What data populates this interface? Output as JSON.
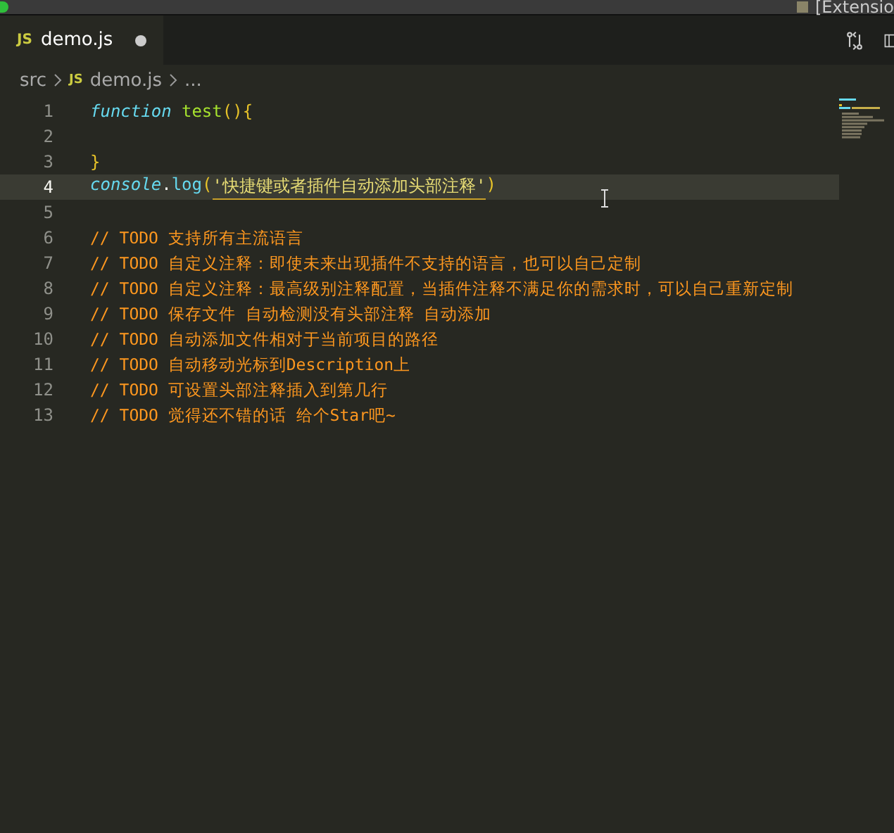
{
  "title_bar": {
    "text": "[Extensio"
  },
  "tabs": [
    {
      "icon": "JS",
      "label": "demo.js",
      "selected": true,
      "modified": true
    }
  ],
  "breadcrumb": [
    {
      "label": "src"
    },
    {
      "icon": "JS",
      "label": "demo.js"
    },
    {
      "label": "..."
    }
  ],
  "lines": [
    {
      "number": "1",
      "current": false,
      "tokens": [
        {
          "kind": "keyword",
          "text": "function"
        },
        {
          "kind": "func",
          "text": "test",
          "space_before": true
        },
        {
          "kind": "bracket",
          "text": "(){"
        }
      ]
    },
    {
      "number": "2",
      "current": false
    },
    {
      "number": "3",
      "current": false,
      "tokens": [
        {
          "kind": "bracket",
          "text": "}"
        }
      ]
    },
    {
      "number": "4",
      "current": true,
      "tokens": [
        {
          "kind": "object",
          "text": "console"
        },
        {
          "kind": "plain",
          "text": "."
        },
        {
          "kind": "method",
          "text": "log"
        },
        {
          "kind": "bracket",
          "text": "("
        },
        {
          "kind": "string",
          "text": "'快捷键或者插件自动添加头部注释'"
        },
        {
          "kind": "bracket",
          "text": ")"
        }
      ]
    },
    {
      "number": "5",
      "current": false
    },
    {
      "number": "6",
      "current": false,
      "tokens": [
        {
          "kind": "comment",
          "text": "// TODO 支持所有主流语言"
        }
      ]
    },
    {
      "number": "7",
      "current": false,
      "tokens": [
        {
          "kind": "comment",
          "text": "// TODO 自定义注释：即使未来出现插件不支持的语言，也可以自己定制"
        }
      ]
    },
    {
      "number": "8",
      "current": false,
      "tokens": [
        {
          "kind": "comment",
          "text": "// TODO 自定义注释：最高级别注释配置，当插件注释不满足你的需求时，可以自己重新定制"
        }
      ]
    },
    {
      "number": "9",
      "current": false,
      "tokens": [
        {
          "kind": "comment",
          "text": "// TODO 保存文件 自动检测没有头部注释 自动添加"
        }
      ]
    },
    {
      "number": "10",
      "current": false,
      "tokens": [
        {
          "kind": "comment",
          "text": "// TODO 自动添加文件相对于当前项目的路径"
        }
      ]
    },
    {
      "number": "11",
      "current": false,
      "tokens": [
        {
          "kind": "comment",
          "text": "// TODO 自动移动光标到Description上"
        }
      ]
    },
    {
      "number": "12",
      "current": false,
      "tokens": [
        {
          "kind": "comment",
          "text": "// TODO 可设置头部注释插入到第几行"
        }
      ]
    },
    {
      "number": "13",
      "current": false,
      "tokens": [
        {
          "kind": "comment",
          "text": "// TODO 觉得还不错的话 给个Star吧~"
        }
      ]
    }
  ]
}
